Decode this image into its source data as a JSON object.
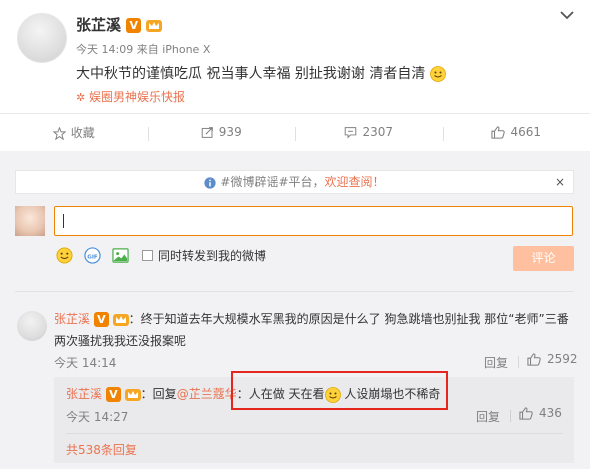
{
  "post": {
    "author": "张芷溪",
    "meta": "今天 14:09 来自 iPhone X",
    "content": "大中秋节的谨慎吃瓜 祝当事人幸福 别扯我谢谢 清者自清",
    "source": "娱圈男神娱乐快报",
    "verified_badge": "V"
  },
  "actions": {
    "favorite": "收藏",
    "forward_count": "939",
    "comment_count": "2307",
    "like_count": "4661"
  },
  "notice": {
    "text_before": "#微博辟谣#平台，",
    "text_highlight": "欢迎查阅！",
    "close": "×"
  },
  "composer": {
    "forward_label": "同时转发到我的微博",
    "submit_label": "评论"
  },
  "comment": {
    "author": "张芷溪",
    "badge": "V",
    "text": "：终于知道去年大规模水军黑我的原因是什么了 狗急跳墙也别扯我 那位“老师”三番两次骚扰我我还没报案呢",
    "time": "今天 14:14",
    "reply_label": "回复",
    "likes": "2592"
  },
  "sub_reply": {
    "author": "张芷溪",
    "badge": "V",
    "prefix": "：回复",
    "mention": "@芷兰蔻华",
    "text_a": "：人在做 天在看",
    "text_b": " 人设崩塌也不稀奇",
    "time": "今天 14:27",
    "reply_label": "回复",
    "likes": "436"
  },
  "more_replies": "共538条回复",
  "colors": {
    "accent": "#eb7350",
    "badge": "#f08300",
    "highlight_border": "#e3261e"
  }
}
